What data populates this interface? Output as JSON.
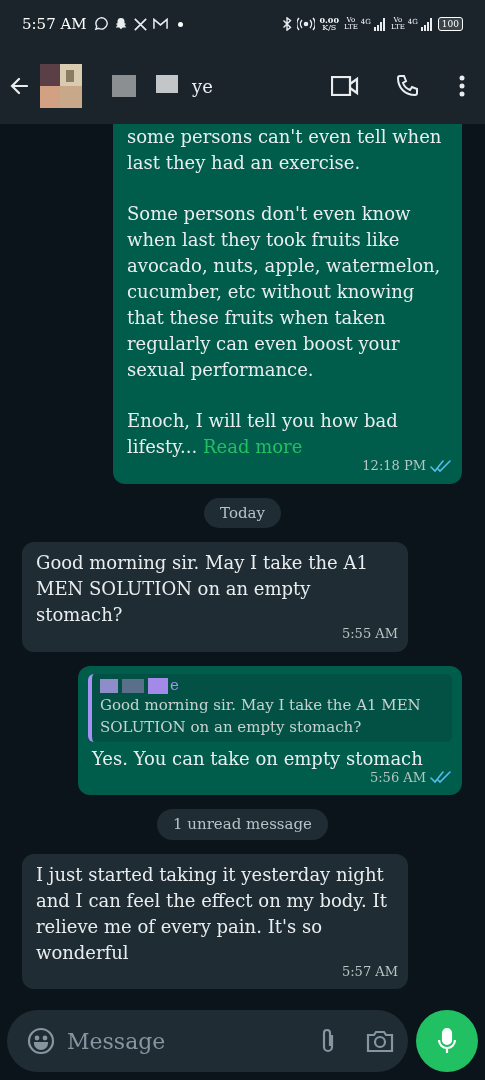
{
  "status_bar": {
    "time": "5:57 AM",
    "speed": "0.00",
    "speed_unit": "K/S",
    "sims": [
      {
        "volte": "Vo",
        "lte": "LTE",
        "network": "4G"
      },
      {
        "volte": "Vo",
        "lte": "LTE",
        "network": "4G"
      }
    ],
    "battery": "100"
  },
  "header": {
    "name_end": "ye"
  },
  "messages": [
    {
      "kind": "outgoing",
      "paragraphs": [
        "some persons can't even tell when last they had an exercise.",
        "Some persons don't even know when last they took fruits like avocado, nuts, apple, watermelon, cucumber, etc without knowing that these fruits when taken regularly can even boost your sexual performance.",
        "Enoch, I will tell you how bad lifesty..."
      ],
      "read_more": "Read more",
      "time": "12:18 PM",
      "read": true
    },
    {
      "kind": "date",
      "text": "Today"
    },
    {
      "kind": "incoming",
      "paragraphs": [
        "Good morning sir. May I take the A1 MEN SOLUTION on an empty stomach?"
      ],
      "time": "5:55 AM"
    },
    {
      "kind": "outgoing",
      "quote": {
        "name_end": "e",
        "text": "Good morning sir. May I take the A1 MEN SOLUTION on an empty stomach?"
      },
      "paragraphs": [
        "Yes. You can take on empty stomach"
      ],
      "time": "5:56 AM",
      "read": true
    },
    {
      "kind": "unread",
      "text": "1 unread message"
    },
    {
      "kind": "incoming",
      "paragraphs": [
        "I just started taking it yesterday night and I can feel the effect on my body. It relieve me of every pain. It's so wonderful"
      ],
      "time": "5:57 AM"
    }
  ],
  "composer": {
    "placeholder": "Message"
  }
}
